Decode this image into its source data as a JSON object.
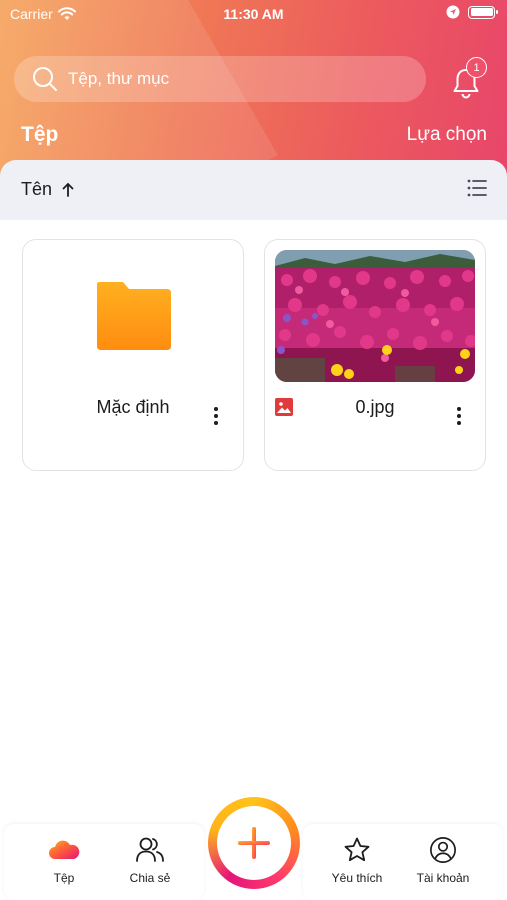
{
  "status_bar": {
    "carrier": "Carrier",
    "time": "11:30 AM",
    "icons": [
      "wifi-icon",
      "location-icon",
      "battery-icon"
    ]
  },
  "search": {
    "placeholder": "Tệp, thư mục",
    "value": ""
  },
  "notifications": {
    "badge_count": "1",
    "icon": "bell-icon"
  },
  "header": {
    "title": "Tệp",
    "select_label": "Lựa chọn"
  },
  "sort": {
    "label": "Tên",
    "direction_icon": "arrow-up-icon",
    "view_icon": "list-view-icon"
  },
  "items": [
    {
      "name": "Mặc định",
      "type": "folder",
      "icon": "folder-icon"
    },
    {
      "name": "0.jpg",
      "type": "image",
      "icon": "image-file-icon"
    }
  ],
  "tabbar": {
    "tabs": [
      {
        "label": "Tệp",
        "icon": "cloud-icon",
        "active": true
      },
      {
        "label": "Chia sẻ",
        "icon": "users-icon"
      },
      {
        "label": "Yêu thích",
        "icon": "star-icon"
      },
      {
        "label": "Tài khoản",
        "icon": "account-icon"
      }
    ],
    "add_icon": "plus-icon"
  },
  "colors": {
    "header_gradient_start": "#f5a25a",
    "header_gradient_end": "#e8456a",
    "folder": "#ffa21a",
    "badge": "#f0506a",
    "image_icon": "#e03a3a"
  }
}
